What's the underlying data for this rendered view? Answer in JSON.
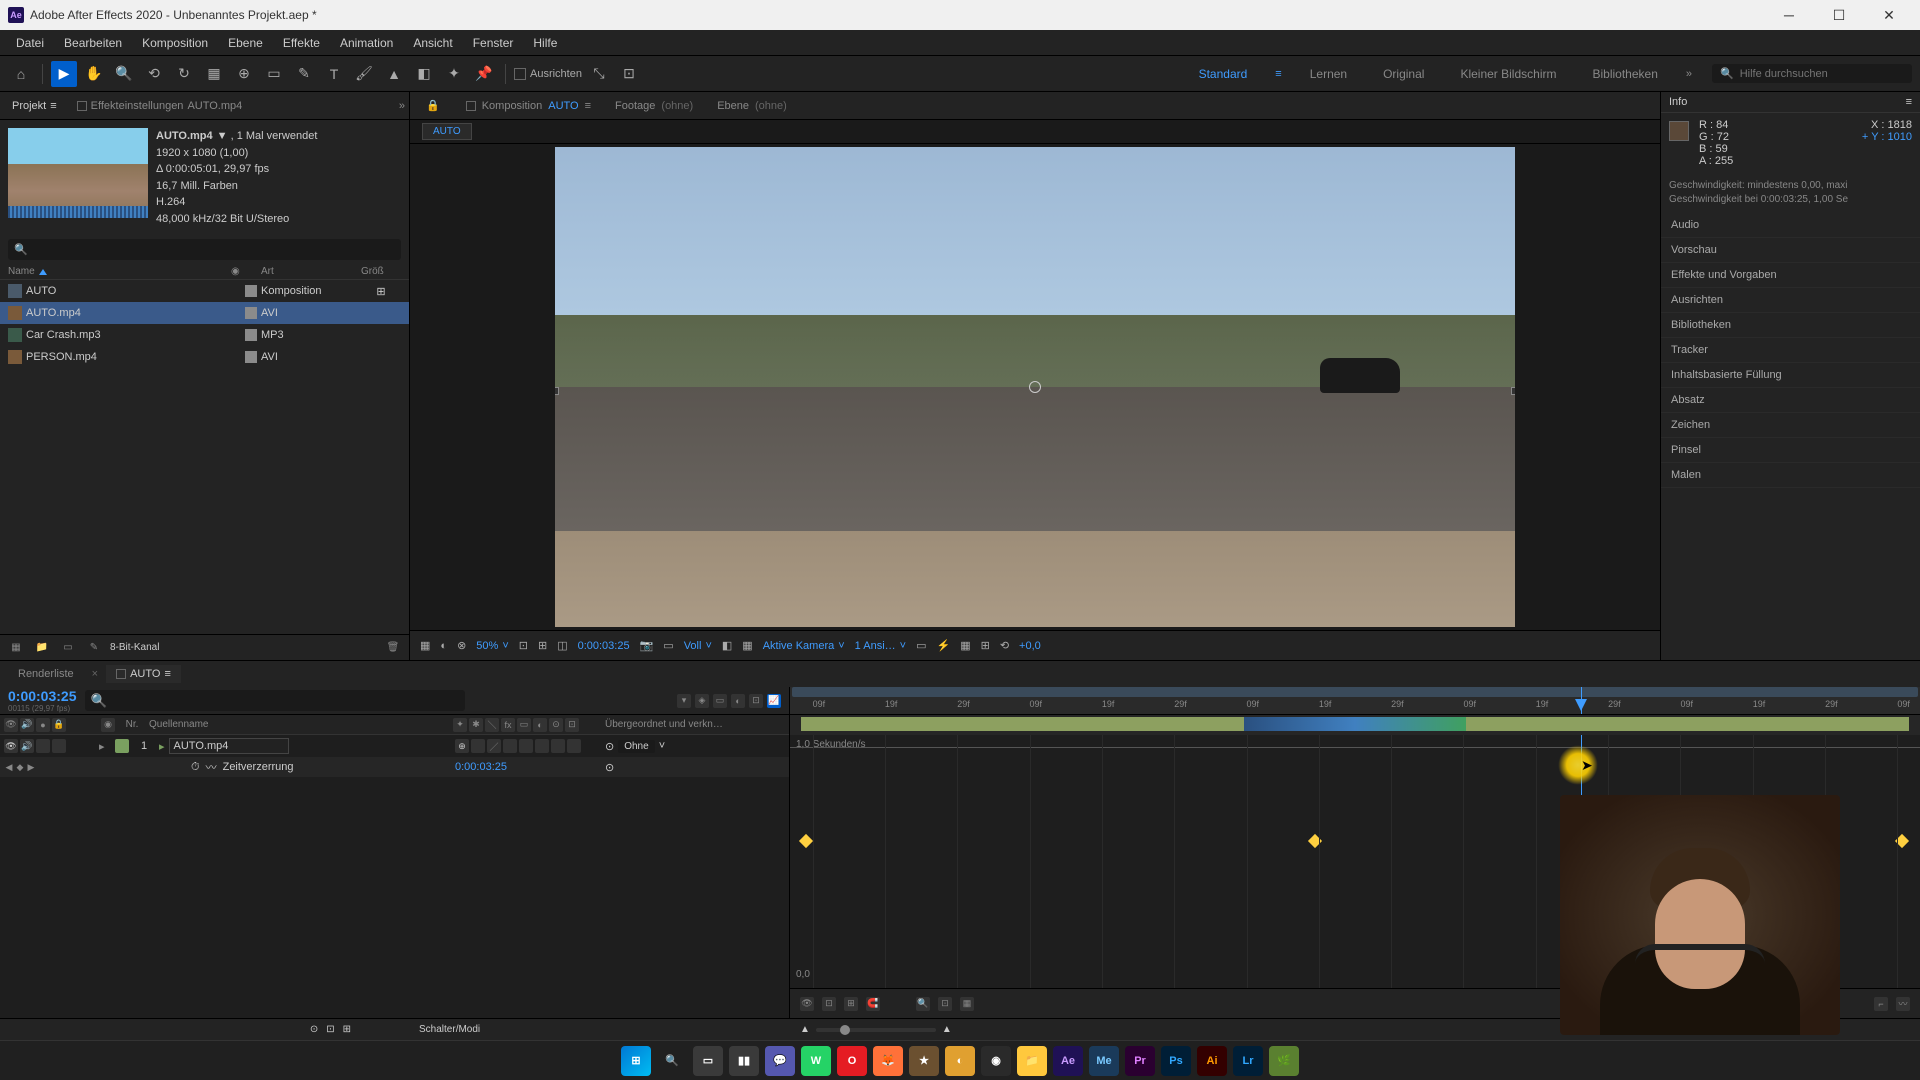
{
  "title": "Adobe After Effects 2020 - Unbenanntes Projekt.aep *",
  "menu": [
    "Datei",
    "Bearbeiten",
    "Komposition",
    "Ebene",
    "Effekte",
    "Animation",
    "Ansicht",
    "Fenster",
    "Hilfe"
  ],
  "toolbar": {
    "anchor_label": "Ausrichten"
  },
  "workspaces": [
    "Standard",
    "Lernen",
    "Original",
    "Kleiner Bildschirm",
    "Bibliotheken"
  ],
  "search_placeholder": "Hilfe durchsuchen",
  "project": {
    "tab1": "Projekt",
    "tab2": "Effekteinstellungen",
    "tab2_val": "AUTO.mp4",
    "asset": {
      "name": "AUTO.mp4",
      "name_suffix": "▼ , 1 Mal verwendet",
      "res": "1920 x 1080 (1,00)",
      "dur": "Δ 0:00:05:01, 29,97 fps",
      "colors": "16,7 Mill. Farben",
      "codec": "H.264",
      "audio": "48,000 kHz/32 Bit U/Stereo"
    },
    "columns": {
      "name": "Name",
      "type": "Art",
      "size": "Größ"
    },
    "rows": [
      {
        "name": "AUTO",
        "type": "Komposition",
        "swatch": "#8b8b8b",
        "icon": "comp",
        "sel": false,
        "flow": true
      },
      {
        "name": "AUTO.mp4",
        "type": "AVI",
        "swatch": "#8b8b8b",
        "icon": "video",
        "sel": true,
        "flow": false
      },
      {
        "name": "Car Crash.mp3",
        "type": "MP3",
        "swatch": "#8b8b8b",
        "icon": "audio",
        "sel": false,
        "flow": false
      },
      {
        "name": "PERSON.mp4",
        "type": "AVI",
        "swatch": "#8b8b8b",
        "icon": "video",
        "sel": false,
        "flow": false
      }
    ],
    "footer_bpc": "8-Bit-Kanal"
  },
  "comp": {
    "tab_comp": "Komposition",
    "tab_comp_name": "AUTO",
    "tab_footage": "Footage",
    "tab_footage_val": "(ohne)",
    "tab_layer": "Ebene",
    "tab_layer_val": "(ohne)",
    "flow_label": "AUTO",
    "viewer": {
      "zoom": "50%",
      "res": "Voll",
      "camera": "Aktive Kamera",
      "views": "1 Ansi…",
      "time": "0:00:03:25",
      "exposure": "+0,0"
    }
  },
  "info": {
    "title": "Info",
    "R": "84",
    "G": "72",
    "B": "59",
    "A": "255",
    "X": "1818",
    "Y": "1010",
    "speed1": "Geschwindigkeit: mindestens 0,00, maxi",
    "speed2": "Geschwindigkeit bei 0:00:03:25, 1,00 Se"
  },
  "right_panels": [
    "Audio",
    "Vorschau",
    "Effekte und Vorgaben",
    "Ausrichten",
    "Bibliotheken",
    "Tracker",
    "Inhaltsbasierte Füllung",
    "Absatz",
    "Zeichen",
    "Pinsel",
    "Malen"
  ],
  "timeline": {
    "tab1": "Renderliste",
    "tab2": "AUTO",
    "time": "0:00:03:25",
    "time_sub": "00115 (29,97 fps)",
    "cols": {
      "num": "Nr.",
      "name": "Quellenname",
      "parent": "Übergeordnet und verkn…"
    },
    "layer": {
      "num": "1",
      "name": "AUTO.mp4",
      "parent": "Ohne"
    },
    "prop": {
      "name": "Zeitverzerrung",
      "value": "0:00:03:25"
    },
    "ruler_ticks": [
      "09f",
      "19f",
      "29f",
      "09f",
      "19f",
      "29f",
      "09f",
      "19f",
      "29f",
      "09f",
      "19f",
      "29f",
      "09f",
      "19f",
      "29f",
      "09f"
    ],
    "graph_ylabel": "1,0 Sekunden/s",
    "graph_yzero": "0,0",
    "footer": "Schalter/Modi"
  },
  "taskbar": {
    "apps": [
      {
        "name": "windows",
        "bg": "",
        "txt": "⊞",
        "cls": "tb-win"
      },
      {
        "name": "search",
        "bg": "",
        "txt": "🔍",
        "cls": "tb-search"
      },
      {
        "name": "taskview",
        "bg": "#3a3a3a",
        "txt": "▭",
        "cls": ""
      },
      {
        "name": "widgets",
        "bg": "#3a3a3a",
        "txt": "▮▮",
        "cls": ""
      },
      {
        "name": "teams",
        "bg": "#5558af",
        "txt": "💬",
        "cls": ""
      },
      {
        "name": "whatsapp",
        "bg": "#25d366",
        "txt": "W",
        "cls": ""
      },
      {
        "name": "opera",
        "bg": "#e51c23",
        "txt": "O",
        "cls": ""
      },
      {
        "name": "firefox",
        "bg": "#ff7139",
        "txt": "🦊",
        "cls": ""
      },
      {
        "name": "app1",
        "bg": "#6b5030",
        "txt": "★",
        "cls": ""
      },
      {
        "name": "app2",
        "bg": "#e0a030",
        "txt": "◐",
        "cls": ""
      },
      {
        "name": "obs",
        "bg": "#2a2a2a",
        "txt": "◉",
        "cls": ""
      },
      {
        "name": "explorer",
        "bg": "#ffc83d",
        "txt": "📁",
        "cls": ""
      },
      {
        "name": "ae",
        "bg": "#1f1155",
        "txt": "Ae",
        "cls": "",
        "color": "#c99cff"
      },
      {
        "name": "me",
        "bg": "#1a3a5a",
        "txt": "Me",
        "cls": "",
        "color": "#7acaff"
      },
      {
        "name": "pr",
        "bg": "#2a0030",
        "txt": "Pr",
        "cls": "",
        "color": "#e080ff"
      },
      {
        "name": "ps",
        "bg": "#001e36",
        "txt": "Ps",
        "cls": "",
        "color": "#31a8ff"
      },
      {
        "name": "ai",
        "bg": "#330000",
        "txt": "Ai",
        "cls": "",
        "color": "#ff9a00"
      },
      {
        "name": "lr",
        "bg": "#001e36",
        "txt": "Lr",
        "cls": "",
        "color": "#31a8ff"
      },
      {
        "name": "app3",
        "bg": "#5a8030",
        "txt": "🌿",
        "cls": ""
      }
    ]
  }
}
